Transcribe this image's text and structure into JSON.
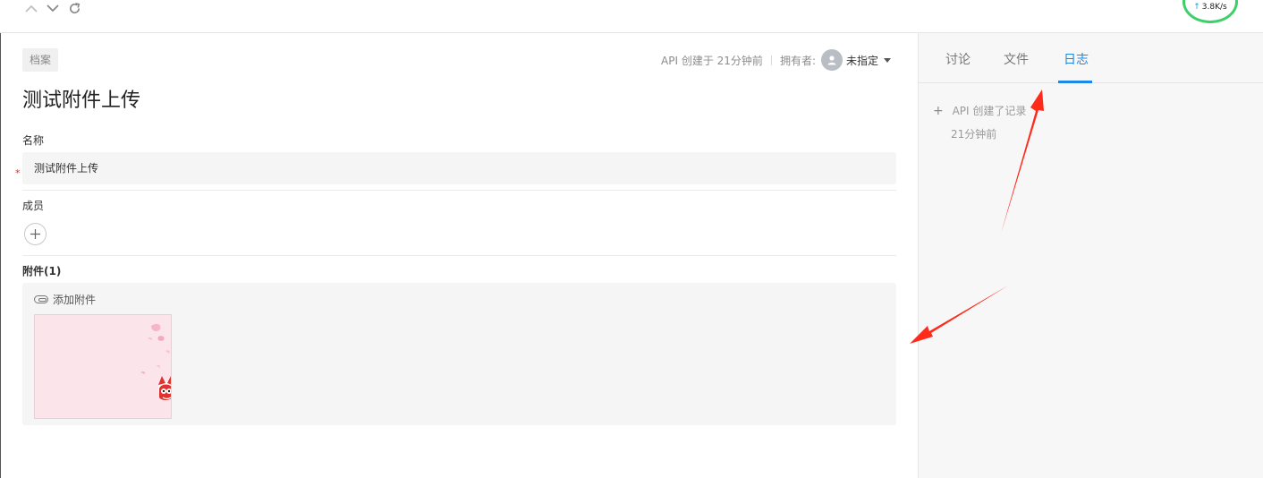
{
  "toolbar": {
    "speed": "3.8K/s"
  },
  "record": {
    "category": "档案",
    "created_by": "API 创建于 21分钟前",
    "owner_label": "拥有者:",
    "owner_value": "未指定",
    "title": "测试附件上传"
  },
  "form": {
    "name_label": "名称",
    "name_value": "测试附件上传",
    "members_label": "成员",
    "attachments_label": "附件(1)",
    "add_attachment": "添加附件"
  },
  "sidebar": {
    "tabs": [
      {
        "label": "讨论",
        "active": false
      },
      {
        "label": "文件",
        "active": false
      },
      {
        "label": "日志",
        "active": true
      }
    ],
    "log": {
      "action": "API 创建了记录",
      "time": "21分钟前"
    }
  },
  "colors": {
    "accent": "#1e88e5",
    "required": "#f5222d",
    "annotation": "#ff2a1a"
  }
}
